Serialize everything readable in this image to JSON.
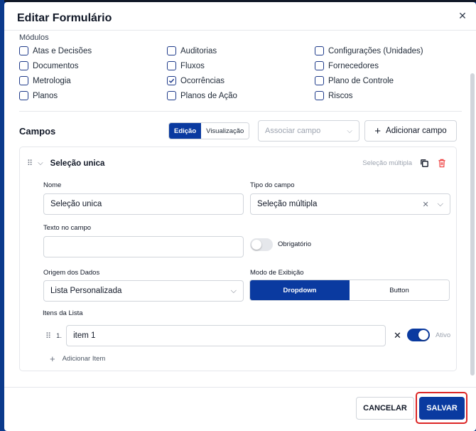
{
  "modal": {
    "title": "Editar Formulário",
    "close_icon": "close-icon"
  },
  "modules": {
    "label": "Módulos",
    "items": [
      {
        "label": "Atas e Decisões",
        "checked": false
      },
      {
        "label": "Auditorias",
        "checked": false
      },
      {
        "label": "Configurações (Unidades)",
        "checked": false
      },
      {
        "label": "Documentos",
        "checked": false
      },
      {
        "label": "Fluxos",
        "checked": false
      },
      {
        "label": "Fornecedores",
        "checked": false
      },
      {
        "label": "Metrologia",
        "checked": false
      },
      {
        "label": "Ocorrências",
        "checked": true
      },
      {
        "label": "Plano de Controle",
        "checked": false
      },
      {
        "label": "Planos",
        "checked": false
      },
      {
        "label": "Planos de Ação",
        "checked": false
      },
      {
        "label": "Riscos",
        "checked": false
      }
    ]
  },
  "campos": {
    "title": "Campos",
    "tab_edit": "Edição",
    "tab_view": "Visualização",
    "associate_placeholder": "Associar campo",
    "add_field_label": "Adicionar campo"
  },
  "field_card": {
    "title": "Seleção unica",
    "type_hint": "Seleção múltipla",
    "name_label": "Nome",
    "name_value": "Seleção unica",
    "type_label": "Tipo do campo",
    "type_value": "Seleção múltipla",
    "placeholder_label": "Texto no campo",
    "placeholder_value": "",
    "required_label": "Obrigatório",
    "required": false,
    "source_label": "Origem dos Dados",
    "source_value": "Lista Personalizada",
    "display_label": "Modo de Exibição",
    "display_options": [
      "Dropdown",
      "Button"
    ],
    "display_selected": "Dropdown",
    "list_label": "Itens da Lista",
    "items": [
      {
        "number": "1.",
        "value": "item 1",
        "active": true,
        "active_label": "Ativo"
      }
    ],
    "add_item_label": "Adicionar Item"
  },
  "footer": {
    "cancel_label": "CANCELAR",
    "save_label": "SALVAR"
  },
  "colors": {
    "primary": "#0a3aa0",
    "highlight": "#dc2626",
    "danger_icon": "#ef4444"
  }
}
